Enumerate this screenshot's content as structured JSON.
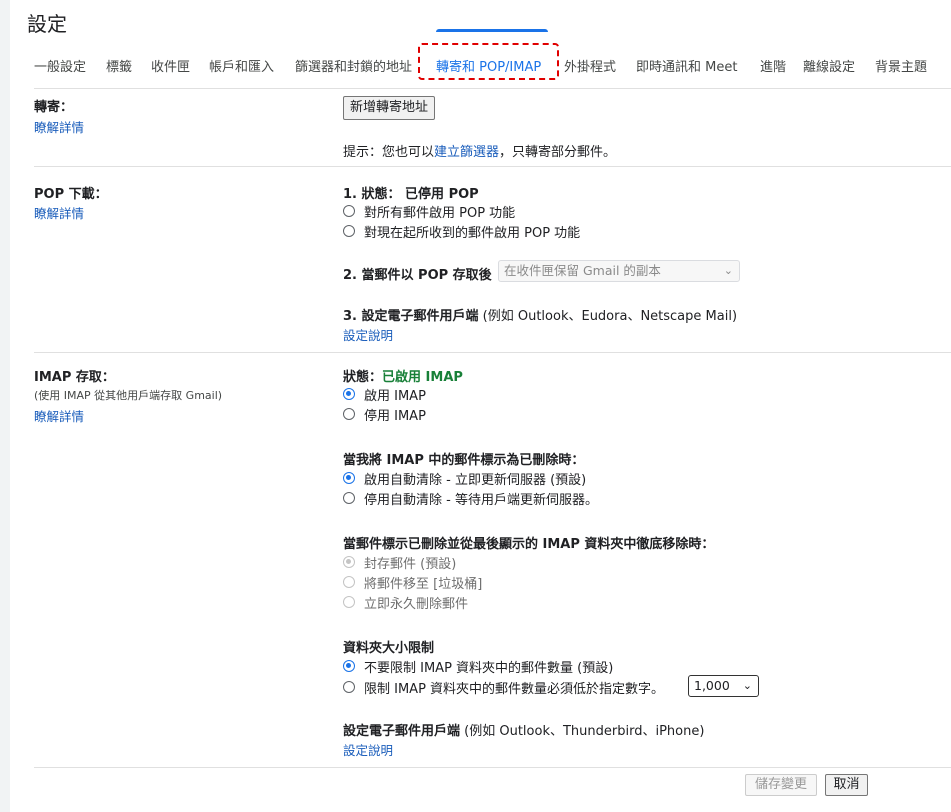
{
  "title": "設定",
  "tabs": [
    {
      "label": "一般設定"
    },
    {
      "label": "標籤"
    },
    {
      "label": "收件匣"
    },
    {
      "label": "帳戶和匯入"
    },
    {
      "label": "篩選器和封鎖的地址"
    },
    {
      "label": "轉寄和 POP/IMAP"
    },
    {
      "label": "外掛程式"
    },
    {
      "label": "即時通訊和 Meet"
    },
    {
      "label": "進階"
    },
    {
      "label": "離線設定"
    },
    {
      "label": "背景主題"
    }
  ],
  "forwarding": {
    "label": "轉寄：",
    "learn_more": "瞭解詳情",
    "add_button": "新增轉寄地址",
    "tip_prefix": "提示：您也可以",
    "tip_link": "建立篩選器",
    "tip_suffix": "，只轉寄部分郵件。"
  },
  "pop": {
    "label": "POP 下載：",
    "learn_more": "瞭解詳情",
    "status_prefix": "1. 狀態：",
    "status_value": "已停用 POP",
    "opt_all": "對所有郵件啟用 POP 功能",
    "opt_now": "對現在起所收到的郵件啟用 POP 功能",
    "when_access": "2. 當郵件以 POP 存取後",
    "when_access_value": "在收件匣保留 Gmail 的副本",
    "configure": "3. 設定電子郵件用戶端",
    "configure_suffix": "(例如 Outlook、Eudora、Netscape Mail)",
    "config_link": "設定說明"
  },
  "imap": {
    "label": "IMAP 存取：",
    "sub": "(使用 IMAP 從其他用戶端存取 Gmail)",
    "learn_more": "瞭解詳情",
    "status_prefix": "狀態：",
    "status_value": "已啟用 IMAP",
    "enable": "啟用 IMAP",
    "disable": "停用 IMAP",
    "deleted_heading": "當我將 IMAP 中的郵件標示為已刪除時：",
    "auto_on": "啟用自動清除 - 立即更新伺服器 (預設)",
    "auto_off": "停用自動清除 - 等待用戶端更新伺服器。",
    "expunge_heading": "當郵件標示已刪除並從最後顯示的 IMAP 資料夾中徹底移除時：",
    "archive": "封存郵件 (預設)",
    "trash": "將郵件移至 [垃圾桶]",
    "delete_forever": "立即永久刪除郵件",
    "folder_heading": "資料夾大小限制",
    "no_limit": "不要限制 IMAP 資料夾中的郵件數量 (預設)",
    "limit": "限制 IMAP 資料夾中的郵件數量必須低於指定數字。",
    "limit_value": "1,000",
    "configure": "設定電子郵件用戶端",
    "configure_suffix": "(例如 Outlook、Thunderbird、iPhone)",
    "config_link": "設定說明"
  },
  "footer": {
    "save": "儲存變更",
    "cancel": "取消"
  },
  "colors": {
    "accent": "#1a73e8",
    "green": "#188038",
    "highlight": "#e00000"
  }
}
